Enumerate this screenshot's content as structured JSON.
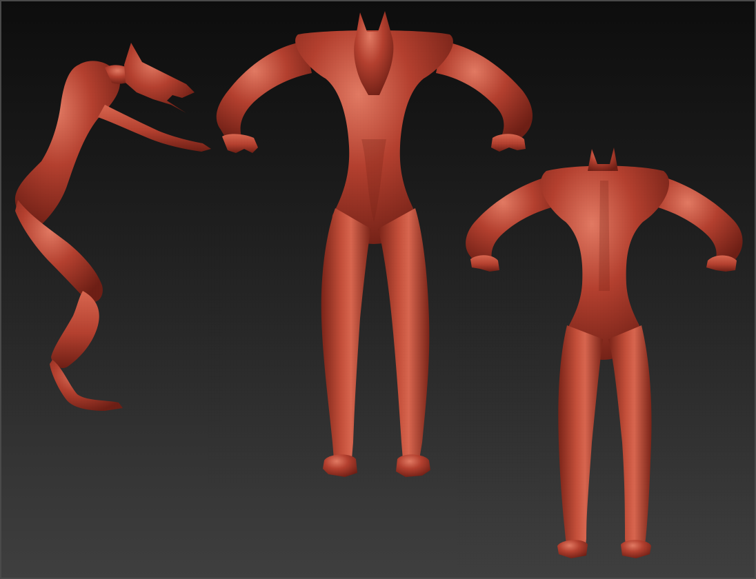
{
  "canvas": {
    "background_top": "#0d0d0d",
    "background_bottom": "#3f3f3f",
    "border_color": "#4a4a4a"
  },
  "model": {
    "material_color": "#b4402f",
    "shadow_color": "#6e1f15",
    "highlight_color": "#e27a63",
    "views": [
      "side",
      "front",
      "back"
    ]
  }
}
